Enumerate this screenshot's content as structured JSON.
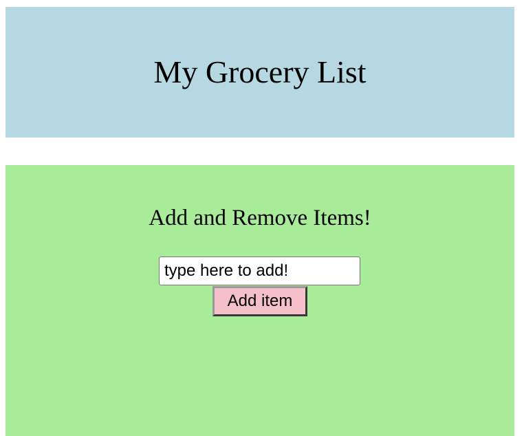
{
  "header": {
    "title": "My Grocery List",
    "background_color": "#b6d8e3"
  },
  "panel": {
    "heading": "Add and Remove Items!",
    "background_color": "#a8ec99",
    "input": {
      "value": "",
      "placeholder": "type here to add!"
    },
    "add_button_label": "Add item",
    "add_button_color": "#f6c0cb"
  }
}
